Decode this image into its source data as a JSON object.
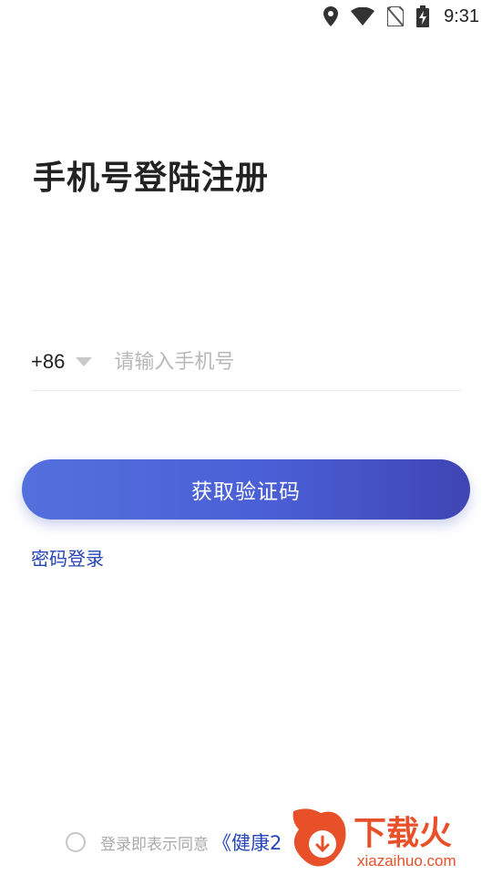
{
  "status_bar": {
    "time": "9:31",
    "icons": [
      "location-icon",
      "wifi-icon",
      "no-sim-icon",
      "battery-charging-icon"
    ]
  },
  "login": {
    "title": "手机号登陆注册",
    "country_code": "+86",
    "phone_placeholder": "请输入手机号",
    "phone_value": "",
    "get_code_label": "获取验证码",
    "password_login_label": "密码登录"
  },
  "agreement": {
    "checked": false,
    "prefix": "登录即表示同意",
    "link_text": "《健康2"
  },
  "watermark": {
    "brand_text": "下载火",
    "url_text": "xiazaihuo.com"
  },
  "colors": {
    "accent": "#4a5fd6",
    "link": "#2545b8",
    "watermark": "#e8502a"
  }
}
